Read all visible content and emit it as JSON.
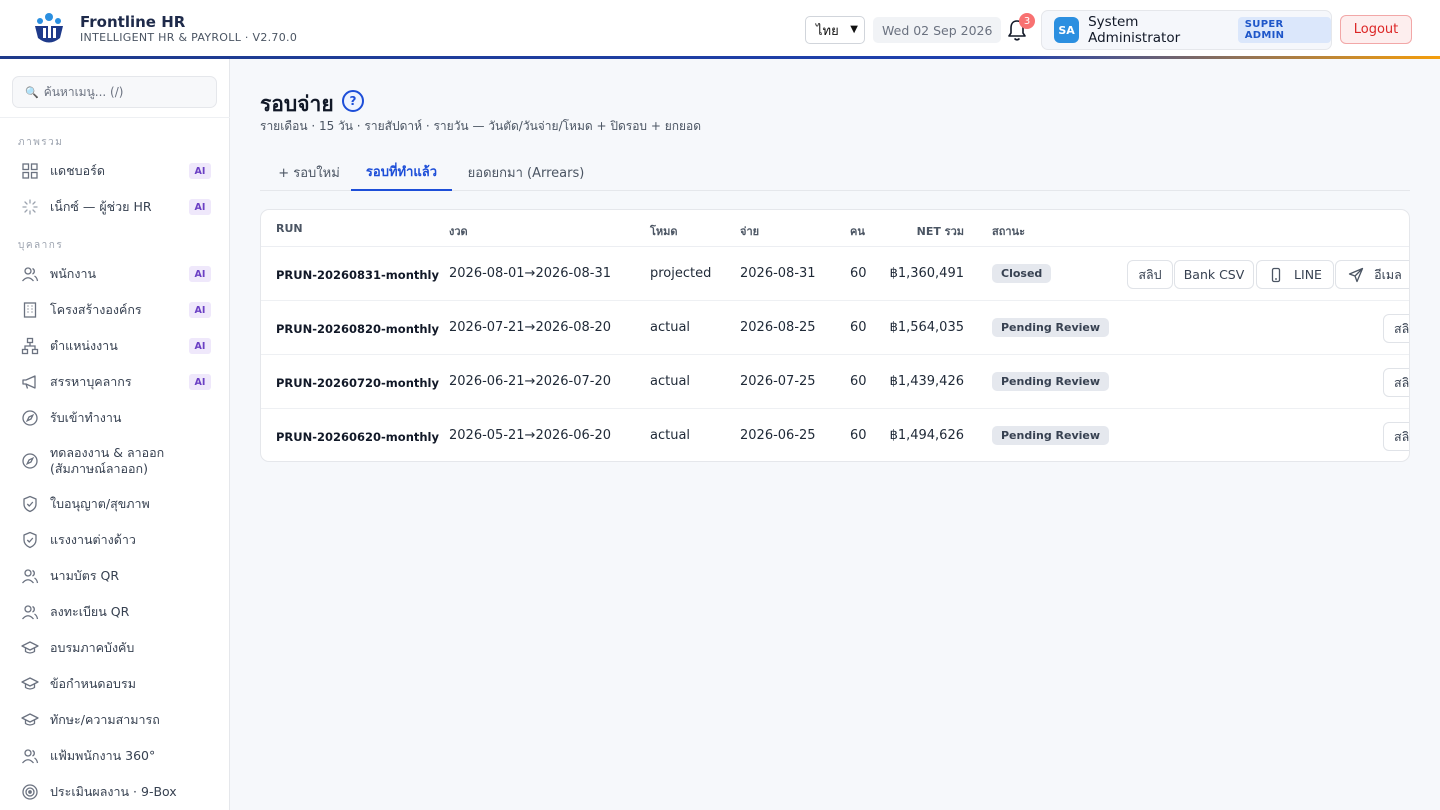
{
  "app": {
    "name": "Frontline HR",
    "subtitle": "INTELLIGENT HR & PAYROLL · V2.70.0"
  },
  "header": {
    "language": "ไทย",
    "date": "Wed 02 Sep 2026",
    "notification_count": "3",
    "user_initials": "SA",
    "user_name": "System Administrator",
    "user_role": "SUPER ADMIN",
    "logout_label": "Logout"
  },
  "sidebar": {
    "search_placeholder": "ค้นหาเมนู... (/)",
    "sections": [
      {
        "title": "ภาพรวม",
        "items": [
          {
            "label": "แดชบอร์ด",
            "icon": "grid-icon",
            "ai": "AI"
          },
          {
            "label": "เน็กซ์ — ผู้ช่วย HR",
            "icon": "sparkle-icon",
            "ai": "AI"
          }
        ]
      },
      {
        "title": "บุคลากร",
        "items": [
          {
            "label": "พนักงาน",
            "icon": "users-icon",
            "ai": "AI"
          },
          {
            "label": "โครงสร้างองค์กร",
            "icon": "building-icon",
            "ai": "AI"
          },
          {
            "label": "ตำแหน่งงาน",
            "icon": "org-chart-icon",
            "ai": "AI"
          },
          {
            "label": "สรรหาบุคลากร",
            "icon": "megaphone-icon",
            "ai": "AI"
          },
          {
            "label": "รับเข้าทำงาน",
            "icon": "compass-icon"
          },
          {
            "label": "ทดลองงาน & ลาออก (สัมภาษณ์ลาออก)",
            "icon": "compass-icon"
          },
          {
            "label": "ใบอนุญาต/สุขภาพ",
            "icon": "shield-check-icon"
          },
          {
            "label": "แรงงานต่างด้าว",
            "icon": "shield-check-icon"
          },
          {
            "label": "นามบัตร QR",
            "icon": "users-icon"
          },
          {
            "label": "ลงทะเบียน QR",
            "icon": "users-icon"
          },
          {
            "label": "อบรมภาคบังคับ",
            "icon": "graduation-cap-icon"
          },
          {
            "label": "ข้อกำหนดอบรม",
            "icon": "graduation-cap-icon"
          },
          {
            "label": "ทักษะ/ความสามารถ",
            "icon": "graduation-cap-icon"
          },
          {
            "label": "แฟ้มพนักงาน 360°",
            "icon": "users-icon"
          },
          {
            "label": "ประเมินผลงาน · 9-Box",
            "icon": "target-icon"
          }
        ]
      }
    ]
  },
  "page": {
    "title": "รอบจ่าย",
    "help": "?",
    "subtitle": "รายเดือน · 15 วัน · รายสัปดาห์ · รายวัน — วันตัด/วันจ่าย/โหมด + ปิดรอบ + ยกยอด",
    "tabs": [
      {
        "label": "+ รอบใหม่",
        "active": false
      },
      {
        "label": "รอบที่ทำแล้ว",
        "active": true
      },
      {
        "label": "ยอดยกมา (Arrears)",
        "active": false
      }
    ]
  },
  "table": {
    "columns": [
      "RUN",
      "งวด",
      "โหมด",
      "จ่าย",
      "คน",
      "NET รวม",
      "สถานะ"
    ],
    "rows": [
      {
        "run": "PRUN-20260831-monthly",
        "period": "2026-08-01→2026-08-31",
        "mode": "projected",
        "pay_date": "2026-08-31",
        "count": "60",
        "net": "฿1,360,491",
        "status": "Closed"
      },
      {
        "run": "PRUN-20260820-monthly",
        "period": "2026-07-21→2026-08-20",
        "mode": "actual",
        "pay_date": "2026-08-25",
        "count": "60",
        "net": "฿1,564,035",
        "status": "Pending Review"
      },
      {
        "run": "PRUN-20260720-monthly",
        "period": "2026-06-21→2026-07-20",
        "mode": "actual",
        "pay_date": "2026-07-25",
        "count": "60",
        "net": "฿1,439,426",
        "status": "Pending Review"
      },
      {
        "run": "PRUN-20260620-monthly",
        "period": "2026-05-21→2026-06-20",
        "mode": "actual",
        "pay_date": "2026-06-25",
        "count": "60",
        "net": "฿1,494,626",
        "status": "Pending Review"
      }
    ],
    "row_actions": {
      "slip": "สลิป",
      "bank_csv": "Bank CSV",
      "line": "LINE",
      "email": "อีเมล",
      "slip_truncated": "สลิ"
    }
  },
  "colors": {
    "accent": "#1d4ed8",
    "ai_badge": "#6b3fc4",
    "logout": "#dc2626",
    "avatar": "#2b8fe0"
  }
}
